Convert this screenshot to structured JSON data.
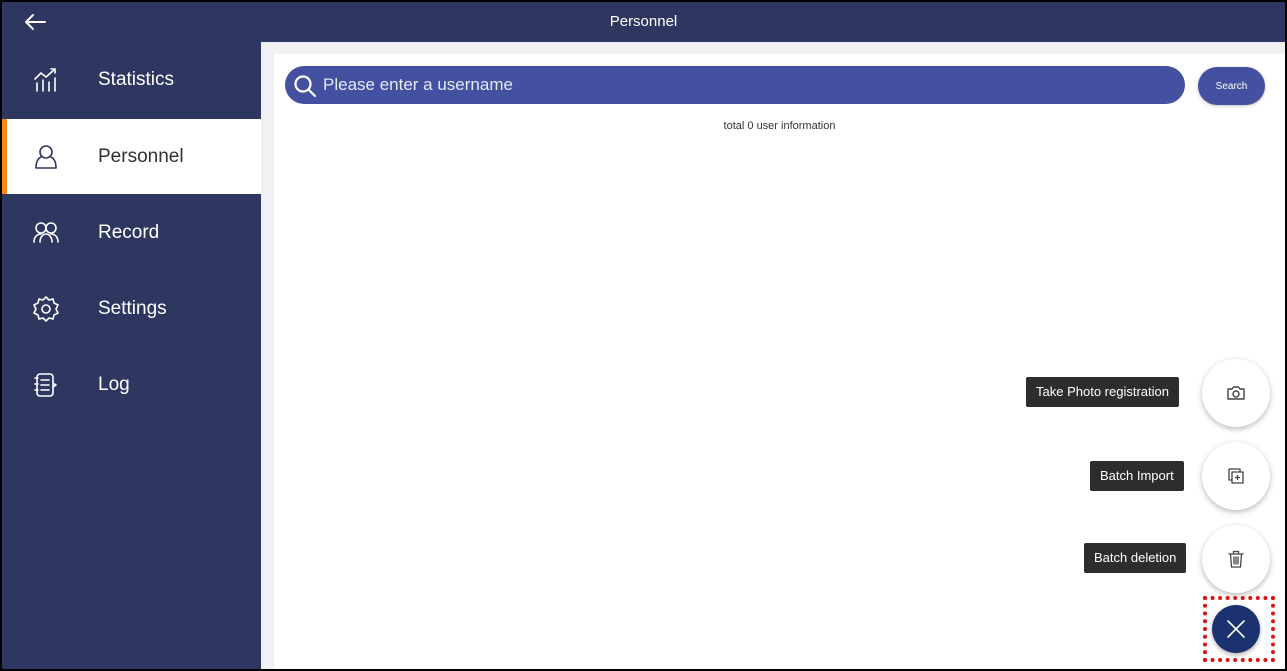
{
  "header": {
    "title": "Personnel"
  },
  "sidebar": {
    "items": [
      {
        "label": "Statistics",
        "icon": "statistics-icon",
        "active": false
      },
      {
        "label": "Personnel",
        "icon": "person-icon",
        "active": true
      },
      {
        "label": "Record",
        "icon": "group-icon",
        "active": false
      },
      {
        "label": "Settings",
        "icon": "gear-icon",
        "active": false
      },
      {
        "label": "Log",
        "icon": "log-icon",
        "active": false
      }
    ]
  },
  "search": {
    "placeholder": "Please enter a username",
    "value": "",
    "button_label": "Search"
  },
  "summary": {
    "total_text": "total 0 user information"
  },
  "fab_menu": {
    "actions": [
      {
        "label": "Take Photo registration",
        "icon": "camera-icon"
      },
      {
        "label": "Batch Import",
        "icon": "import-icon"
      },
      {
        "label": "Batch deletion",
        "icon": "trash-icon"
      }
    ],
    "main_icon": "close-icon"
  },
  "colors": {
    "sidebar_bg": "#2e3760",
    "accent": "#4451a0",
    "active_indicator": "#f08a1c",
    "fab_main": "#1c3270",
    "highlight": "#e01010"
  }
}
